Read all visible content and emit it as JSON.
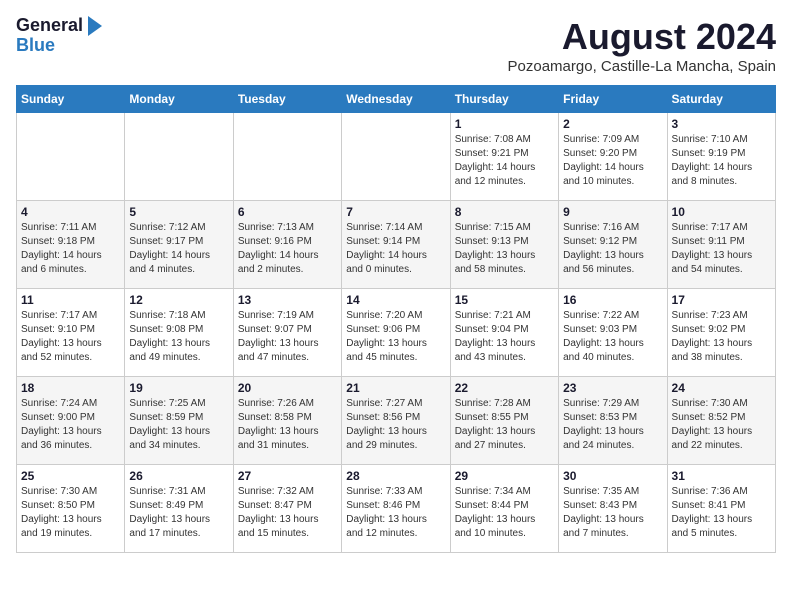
{
  "header": {
    "logo_line1": "General",
    "logo_line2": "Blue",
    "title": "August 2024",
    "subtitle": "Pozoamargo, Castille-La Mancha, Spain"
  },
  "days_of_week": [
    "Sunday",
    "Monday",
    "Tuesday",
    "Wednesday",
    "Thursday",
    "Friday",
    "Saturday"
  ],
  "weeks": [
    [
      {
        "day": "",
        "info": ""
      },
      {
        "day": "",
        "info": ""
      },
      {
        "day": "",
        "info": ""
      },
      {
        "day": "",
        "info": ""
      },
      {
        "day": "1",
        "info": "Sunrise: 7:08 AM\nSunset: 9:21 PM\nDaylight: 14 hours\nand 12 minutes."
      },
      {
        "day": "2",
        "info": "Sunrise: 7:09 AM\nSunset: 9:20 PM\nDaylight: 14 hours\nand 10 minutes."
      },
      {
        "day": "3",
        "info": "Sunrise: 7:10 AM\nSunset: 9:19 PM\nDaylight: 14 hours\nand 8 minutes."
      }
    ],
    [
      {
        "day": "4",
        "info": "Sunrise: 7:11 AM\nSunset: 9:18 PM\nDaylight: 14 hours\nand 6 minutes."
      },
      {
        "day": "5",
        "info": "Sunrise: 7:12 AM\nSunset: 9:17 PM\nDaylight: 14 hours\nand 4 minutes."
      },
      {
        "day": "6",
        "info": "Sunrise: 7:13 AM\nSunset: 9:16 PM\nDaylight: 14 hours\nand 2 minutes."
      },
      {
        "day": "7",
        "info": "Sunrise: 7:14 AM\nSunset: 9:14 PM\nDaylight: 14 hours\nand 0 minutes."
      },
      {
        "day": "8",
        "info": "Sunrise: 7:15 AM\nSunset: 9:13 PM\nDaylight: 13 hours\nand 58 minutes."
      },
      {
        "day": "9",
        "info": "Sunrise: 7:16 AM\nSunset: 9:12 PM\nDaylight: 13 hours\nand 56 minutes."
      },
      {
        "day": "10",
        "info": "Sunrise: 7:17 AM\nSunset: 9:11 PM\nDaylight: 13 hours\nand 54 minutes."
      }
    ],
    [
      {
        "day": "11",
        "info": "Sunrise: 7:17 AM\nSunset: 9:10 PM\nDaylight: 13 hours\nand 52 minutes."
      },
      {
        "day": "12",
        "info": "Sunrise: 7:18 AM\nSunset: 9:08 PM\nDaylight: 13 hours\nand 49 minutes."
      },
      {
        "day": "13",
        "info": "Sunrise: 7:19 AM\nSunset: 9:07 PM\nDaylight: 13 hours\nand 47 minutes."
      },
      {
        "day": "14",
        "info": "Sunrise: 7:20 AM\nSunset: 9:06 PM\nDaylight: 13 hours\nand 45 minutes."
      },
      {
        "day": "15",
        "info": "Sunrise: 7:21 AM\nSunset: 9:04 PM\nDaylight: 13 hours\nand 43 minutes."
      },
      {
        "day": "16",
        "info": "Sunrise: 7:22 AM\nSunset: 9:03 PM\nDaylight: 13 hours\nand 40 minutes."
      },
      {
        "day": "17",
        "info": "Sunrise: 7:23 AM\nSunset: 9:02 PM\nDaylight: 13 hours\nand 38 minutes."
      }
    ],
    [
      {
        "day": "18",
        "info": "Sunrise: 7:24 AM\nSunset: 9:00 PM\nDaylight: 13 hours\nand 36 minutes."
      },
      {
        "day": "19",
        "info": "Sunrise: 7:25 AM\nSunset: 8:59 PM\nDaylight: 13 hours\nand 34 minutes."
      },
      {
        "day": "20",
        "info": "Sunrise: 7:26 AM\nSunset: 8:58 PM\nDaylight: 13 hours\nand 31 minutes."
      },
      {
        "day": "21",
        "info": "Sunrise: 7:27 AM\nSunset: 8:56 PM\nDaylight: 13 hours\nand 29 minutes."
      },
      {
        "day": "22",
        "info": "Sunrise: 7:28 AM\nSunset: 8:55 PM\nDaylight: 13 hours\nand 27 minutes."
      },
      {
        "day": "23",
        "info": "Sunrise: 7:29 AM\nSunset: 8:53 PM\nDaylight: 13 hours\nand 24 minutes."
      },
      {
        "day": "24",
        "info": "Sunrise: 7:30 AM\nSunset: 8:52 PM\nDaylight: 13 hours\nand 22 minutes."
      }
    ],
    [
      {
        "day": "25",
        "info": "Sunrise: 7:30 AM\nSunset: 8:50 PM\nDaylight: 13 hours\nand 19 minutes."
      },
      {
        "day": "26",
        "info": "Sunrise: 7:31 AM\nSunset: 8:49 PM\nDaylight: 13 hours\nand 17 minutes."
      },
      {
        "day": "27",
        "info": "Sunrise: 7:32 AM\nSunset: 8:47 PM\nDaylight: 13 hours\nand 15 minutes."
      },
      {
        "day": "28",
        "info": "Sunrise: 7:33 AM\nSunset: 8:46 PM\nDaylight: 13 hours\nand 12 minutes."
      },
      {
        "day": "29",
        "info": "Sunrise: 7:34 AM\nSunset: 8:44 PM\nDaylight: 13 hours\nand 10 minutes."
      },
      {
        "day": "30",
        "info": "Sunrise: 7:35 AM\nSunset: 8:43 PM\nDaylight: 13 hours\nand 7 minutes."
      },
      {
        "day": "31",
        "info": "Sunrise: 7:36 AM\nSunset: 8:41 PM\nDaylight: 13 hours\nand 5 minutes."
      }
    ]
  ]
}
